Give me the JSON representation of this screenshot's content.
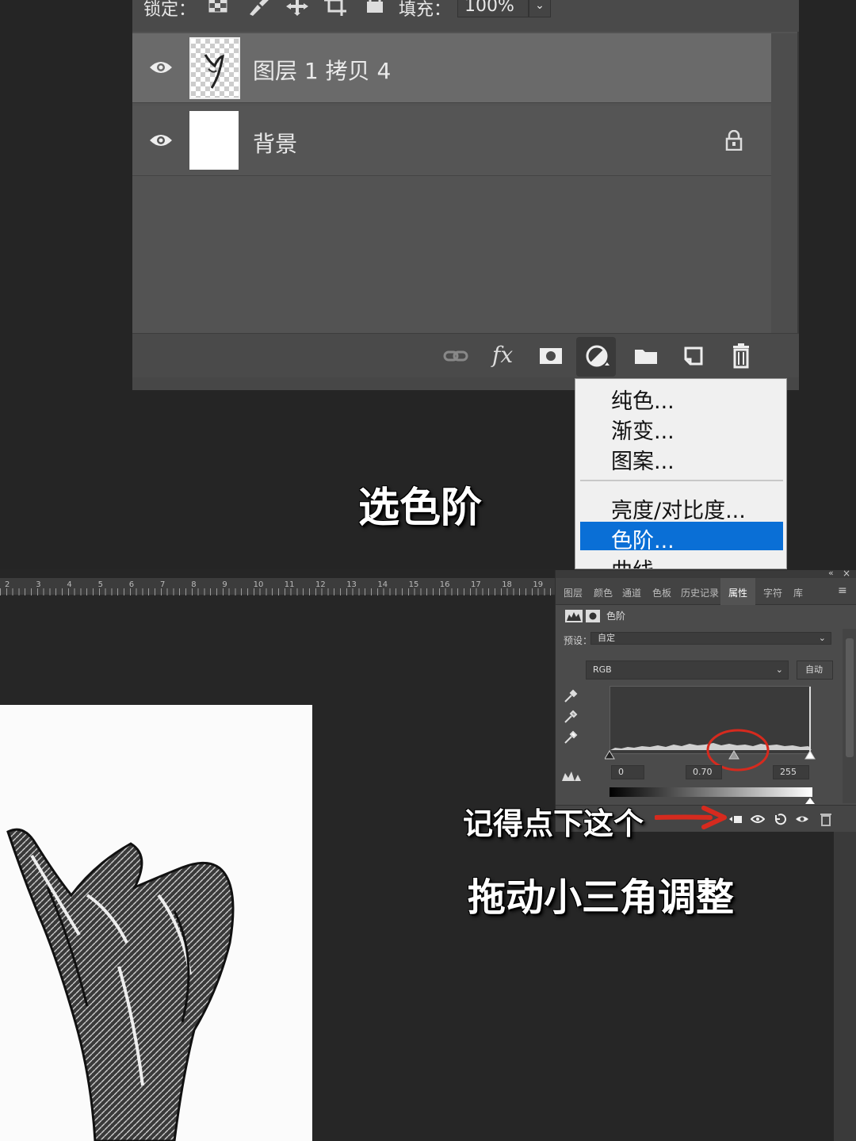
{
  "layers_panel": {
    "lock_label": "锁定：",
    "fill_label": "填充：",
    "fill_value": "100%",
    "layers": [
      {
        "name": "图层 1 拷贝 4",
        "visible": true,
        "selected": true
      },
      {
        "name": "背景",
        "visible": true,
        "locked": true
      }
    ],
    "bottom_icons": [
      "link-icon",
      "fx-icon",
      "mask-icon",
      "adjustment-icon",
      "folder-icon",
      "new-layer-icon",
      "trash-icon"
    ],
    "fx_label": "fx"
  },
  "adjustment_menu": {
    "items": [
      {
        "label": "纯色..."
      },
      {
        "label": "渐变..."
      },
      {
        "label": "图案..."
      },
      {
        "label": "亮度/对比度..."
      },
      {
        "label": "色阶...",
        "highlighted": true
      },
      {
        "label": "曲线..."
      }
    ],
    "highlight_color": "#0a6fd6"
  },
  "ruler": {
    "numbers": [
      "2",
      "3",
      "4",
      "5",
      "6",
      "7",
      "8",
      "9",
      "10",
      "11",
      "12",
      "13",
      "14",
      "15",
      "16",
      "17",
      "18",
      "19"
    ]
  },
  "properties_panel": {
    "tabs": [
      "图层",
      "颜色",
      "通道",
      "色板",
      "历史记录",
      "属性",
      "字符",
      "库"
    ],
    "active_tab": "属性",
    "title": "色阶",
    "preset_label": "预设：",
    "preset_value": "自定",
    "channel_value": "RGB",
    "auto_button": "自动",
    "input_black": "0",
    "input_gamma": "0.70",
    "input_white": "255",
    "collapse_label": "«",
    "close_label": "×"
  },
  "captions": {
    "select_levels": "选色阶",
    "remember_click": "记得点下这个",
    "drag_triangles": "拖动小三角调整"
  },
  "colors": {
    "annotation_red": "#d62a1e",
    "accent_blue": "#0a6fd6"
  }
}
